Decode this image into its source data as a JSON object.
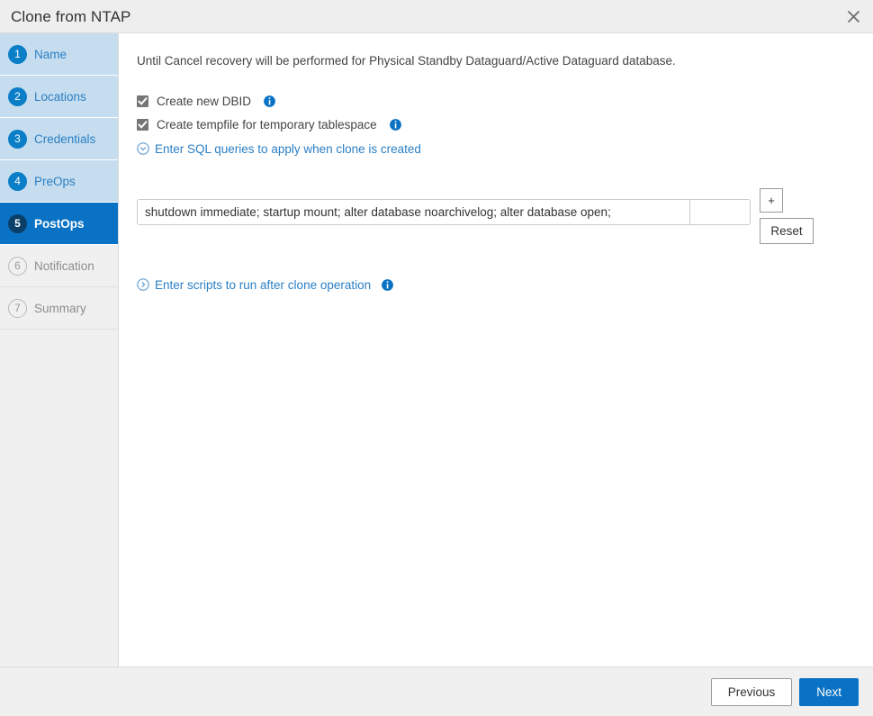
{
  "window": {
    "title": "Clone from NTAP",
    "close_icon": "close-icon"
  },
  "sidebar": {
    "steps": [
      {
        "num": "1",
        "label": "Name",
        "state": "done"
      },
      {
        "num": "2",
        "label": "Locations",
        "state": "done"
      },
      {
        "num": "3",
        "label": "Credentials",
        "state": "done"
      },
      {
        "num": "4",
        "label": "PreOps",
        "state": "done"
      },
      {
        "num": "5",
        "label": "PostOps",
        "state": "active"
      },
      {
        "num": "6",
        "label": "Notification",
        "state": "todo"
      },
      {
        "num": "7",
        "label": "Summary",
        "state": "todo"
      }
    ]
  },
  "content": {
    "intro": "Until Cancel recovery will be performed for Physical Standby Dataguard/Active Dataguard database.",
    "checkboxes": [
      {
        "label": "Create new DBID",
        "checked": true,
        "info_icon": "info-icon"
      },
      {
        "label": "Create tempfile for temporary tablespace",
        "checked": true,
        "info_icon": "info-icon"
      }
    ],
    "sql_section": {
      "toggle_label": "Enter SQL queries to apply when clone is created",
      "toggle_icon": "chevron-down-circle-icon",
      "expanded": true,
      "query_value": "shutdown immediate; startup mount; alter database noarchivelog; alter database open;",
      "query_placeholder": "",
      "aux_value": "",
      "aux_placeholder": "",
      "add_label": "+",
      "reset_label": "Reset"
    },
    "scripts_section": {
      "toggle_label": "Enter scripts to run after clone operation",
      "toggle_icon": "chevron-right-circle-icon",
      "expanded": false,
      "info_icon": "info-icon"
    }
  },
  "footer": {
    "previous_label": "Previous",
    "next_label": "Next"
  },
  "colors": {
    "accent": "#0a72c4",
    "link": "#2b7fc4",
    "step_done_bg": "#c5ddef",
    "active_num_bg": "#0a3f68",
    "header_bg": "#eeeeee",
    "sidebar_bg": "#f0f0f0"
  }
}
